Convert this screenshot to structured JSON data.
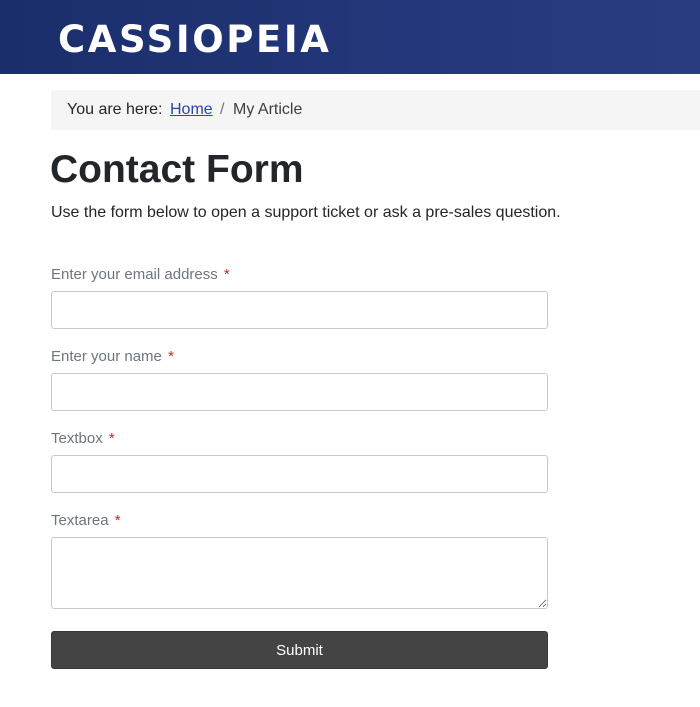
{
  "site": {
    "brand": "CASSIOPEIA"
  },
  "breadcrumb": {
    "prefix": "You are here:",
    "home": "Home",
    "separator": "/",
    "current": "My Article"
  },
  "page": {
    "title": "Contact Form",
    "intro": "Use the form below to open a support ticket or ask a pre-sales question."
  },
  "form": {
    "required_marker": "*",
    "fields": [
      {
        "label": "Enter your email address",
        "value": "",
        "type": "email"
      },
      {
        "label": "Enter your name",
        "value": "",
        "type": "text"
      },
      {
        "label": "Textbox",
        "value": "",
        "type": "text"
      },
      {
        "label": "Textarea",
        "value": "",
        "type": "textarea"
      }
    ],
    "submit_label": "Submit"
  },
  "colors": {
    "header_bg": "#1f3272",
    "link": "#2a46a8",
    "required": "#c52827",
    "button_bg": "#444444"
  }
}
